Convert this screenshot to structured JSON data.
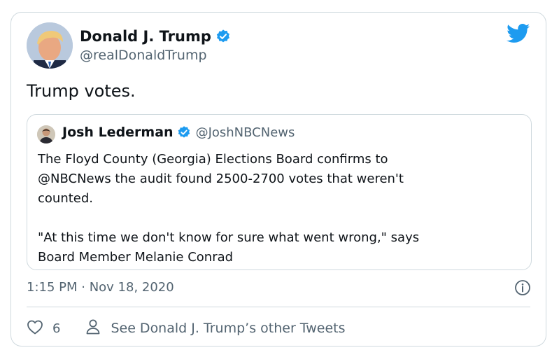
{
  "tweet": {
    "author_name": "Donald J. Trump",
    "author_handle": "@realDonaldTrump",
    "verified": true,
    "text": "Trump votes.",
    "timestamp": "1:15 PM · Nov 18, 2020",
    "likes": "6",
    "other_tweets_label": "See Donald J. Trump’s other Tweets"
  },
  "quoted": {
    "author_name": "Josh Lederman",
    "author_handle": "@JoshNBCNews",
    "verified": true,
    "paragraphs": [
      "The Floyd County (Georgia) Elections Board confirms to",
      "@NBCNews the audit found 2500-2700 votes that weren't",
      "counted.",
      "\"At this time we don't know for sure what went wrong,\" says",
      "Board Member Melanie Conrad"
    ]
  },
  "icons": {
    "brand": "twitter-bird-icon",
    "verified": "verified-badge-icon",
    "info": "info-icon",
    "like": "heart-icon",
    "profile": "person-icon"
  },
  "colors": {
    "brand_blue": "#1d9bf0",
    "text_primary": "#0f1419",
    "text_secondary": "#536471",
    "border": "#cfd9de"
  }
}
